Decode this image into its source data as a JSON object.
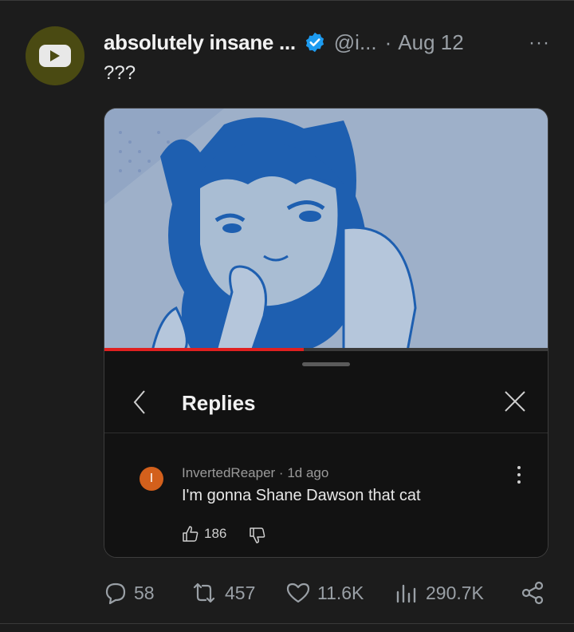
{
  "tweet": {
    "author_name": "absolutely insane ...",
    "handle": "@i...",
    "separator": "·",
    "date": "Aug 12",
    "more_label": "···",
    "text": "???"
  },
  "video": {
    "progress_fraction": 0.45,
    "replies_panel": {
      "title": "Replies",
      "comment": {
        "avatar_initial": "I",
        "username": "InvertedReaper",
        "time": "1d ago",
        "text": "I'm gonna Shane Dawson that cat",
        "likes": "186"
      }
    }
  },
  "actions": {
    "replies": "58",
    "reposts": "457",
    "likes": "11.6K",
    "views": "290.7K"
  },
  "colors": {
    "background": "#1c1c1c",
    "verified_blue": "#1d9bf0",
    "progress_red": "#e02020",
    "comment_avatar": "#d3601c",
    "avatar_bg": "#4a4a12"
  }
}
